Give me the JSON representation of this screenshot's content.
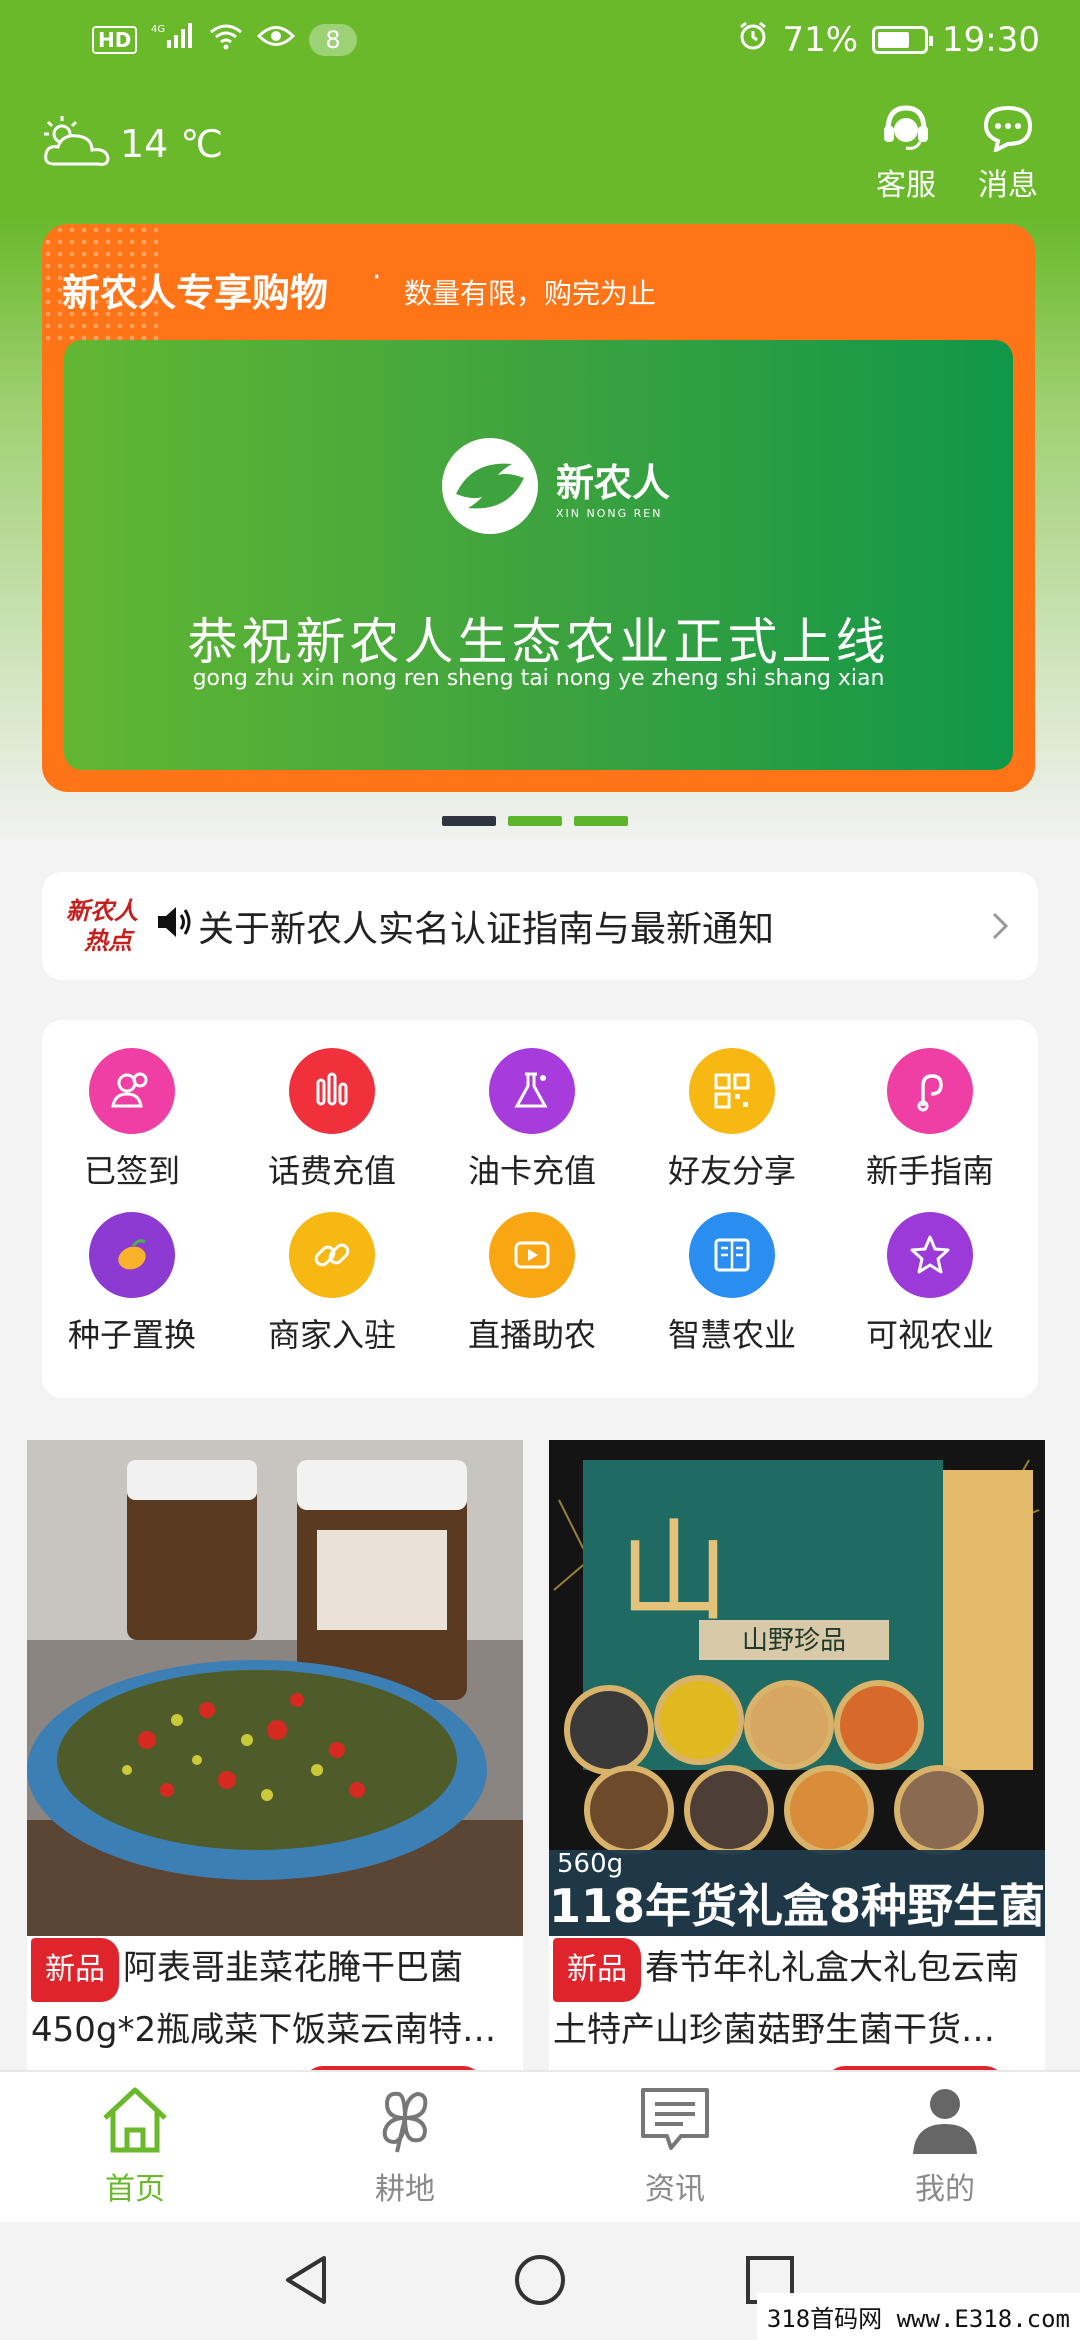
{
  "status_bar": {
    "hd": "HD",
    "network": "4G",
    "badge": "8",
    "battery": "71%",
    "battery_level": 0.71,
    "time": "19:30"
  },
  "header": {
    "weather": "14 ℃",
    "service_label": "客服",
    "message_label": "消息"
  },
  "banner": {
    "title": "新农人专享购物",
    "separator": "·",
    "subtitle": "数量有限，购完为止",
    "logo_name": "新农人",
    "logo_pinyin": "XIN NONG REN",
    "main_text": "恭祝新农人生态农业正式上线",
    "pinyin": "gong zhu xin nong ren sheng tai nong ye zheng shi shang xian"
  },
  "notice": {
    "logo_top": "新农人",
    "logo_bottom": "热点",
    "text": "关于新农人实名认证指南与最新通知"
  },
  "grid": [
    {
      "label": "已签到",
      "icon": "user-group-icon",
      "color": "#f03fa4"
    },
    {
      "label": "话费充值",
      "icon": "bar-chart-icon",
      "color": "#f0313b"
    },
    {
      "label": "油卡充值",
      "icon": "flask-icon",
      "color": "#a73bdb"
    },
    {
      "label": "好友分享",
      "icon": "qr-code-icon",
      "color": "#f8b813"
    },
    {
      "label": "新手指南",
      "icon": "link-s-icon",
      "color": "#f03fa4"
    },
    {
      "label": "种子置换",
      "icon": "mango-icon",
      "color": "#8c3ad2"
    },
    {
      "label": "商家入驻",
      "icon": "chain-link-icon",
      "color": "#f8b813"
    },
    {
      "label": "直播助农",
      "icon": "video-play-icon",
      "color": "#f8a713"
    },
    {
      "label": "智慧农业",
      "icon": "book-icon",
      "color": "#2a8ef0"
    },
    {
      "label": "可视农业",
      "icon": "star-icon",
      "color": "#9b3ad8"
    }
  ],
  "products": [
    {
      "tag": "新品",
      "title": "阿表哥韭菜花腌干巴菌450g*2瓶咸菜下饭菜云南特…",
      "image": "pickled-vegetables-photo"
    },
    {
      "tag": "新品",
      "title": "春节年礼礼盒大礼包云南土特产山珍菌菇野生菌干货…",
      "image": "mushroom-gift-box-photo",
      "image_caption": "118年货礼盒8种野生菌",
      "image_weight": "560g",
      "box_text": "山野珍品"
    }
  ],
  "bottom_nav": [
    {
      "label": "首页",
      "icon": "home-icon",
      "active": true
    },
    {
      "label": "耕地",
      "icon": "clover-icon",
      "active": false
    },
    {
      "label": "资讯",
      "icon": "chat-news-icon",
      "active": false
    },
    {
      "label": "我的",
      "icon": "profile-icon",
      "active": false
    }
  ],
  "watermark": "318首码网 www.E318.com",
  "colors": {
    "brand_green": "#69b92b",
    "banner_orange": "#ff7417",
    "tag_red": "#e0242b",
    "pager_active": "#2e3440",
    "pager_inactive": "#5cb52a"
  }
}
